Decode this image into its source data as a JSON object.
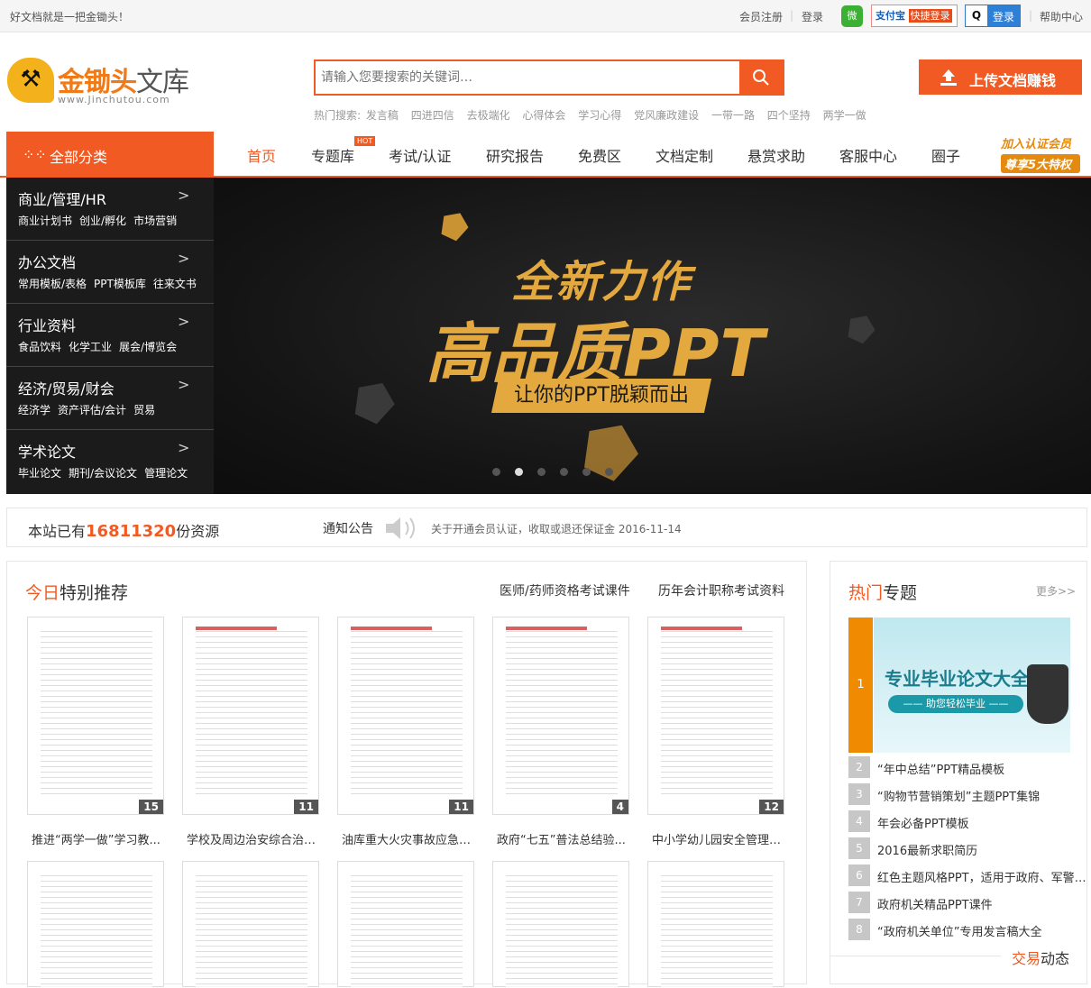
{
  "topbar": {
    "slogan": "好文档就是一把金锄头！",
    "register": "会员注册",
    "login": "登录",
    "wechat_icon": "wechat-icon",
    "alipay_label": "支付宝",
    "fast_login": "快捷登录",
    "qq_login": "登录",
    "help": "帮助中心"
  },
  "logo": {
    "name": "金锄头",
    "name_suffix": "文库",
    "url": "www.Jinchutou.com"
  },
  "search": {
    "placeholder": "请输入您要搜索的关键词…",
    "hot_label": "热门搜索:",
    "hot_terms": [
      "发言稿",
      "四进四信",
      "去极端化",
      "心得体会",
      "学习心得",
      "党风廉政建设",
      "一带一路",
      "四个坚持",
      "两学一做"
    ]
  },
  "upload": {
    "label": "上传文档赚钱"
  },
  "nav": {
    "all_categories": "全部分类",
    "items": [
      "首页",
      "专题库",
      "考试/认证",
      "研究报告",
      "免费区",
      "文档定制",
      "悬赏求助",
      "客服中心",
      "圈子"
    ],
    "hot_badge": "HOT",
    "member_line1": "加入认证会员",
    "member_line2": "尊享5大特权"
  },
  "categories": [
    {
      "title": "商业/管理/HR",
      "subs": [
        "商业计划书",
        "创业/孵化",
        "市场营销"
      ]
    },
    {
      "title": "办公文档",
      "subs": [
        "常用模板/表格",
        "PPT模板库",
        "往来文书"
      ]
    },
    {
      "title": "行业资料",
      "subs": [
        "食品饮料",
        "化学工业",
        "展会/博览会"
      ]
    },
    {
      "title": "经济/贸易/财会",
      "subs": [
        "经济学",
        "资产评估/会计",
        "贸易"
      ]
    },
    {
      "title": "学术论文",
      "subs": [
        "毕业论文",
        "期刊/会议论文",
        "管理论文"
      ]
    }
  ],
  "banner": {
    "line1": "全新力作",
    "line2": "高品质PPT",
    "line3": "让你的PPT脱颖而出",
    "active_slide": 2
  },
  "stats": {
    "prefix": "本站已有",
    "count": "16811320",
    "suffix": "份资源",
    "notice_label": "通知公告",
    "notice_text": "关于开通会员认证，收取或退还保证金",
    "notice_date": "2016-11-14"
  },
  "recommend": {
    "title_highlight": "今日",
    "title_rest": "特别推荐",
    "link1": "医师/药师资格考试课件",
    "link2": "历年会计职称考试资料",
    "docs": [
      {
        "title": "推进“两学一做”学习教...",
        "pages": "15"
      },
      {
        "title": "学校及周边治安综合治理...",
        "pages": "11"
      },
      {
        "title": "油库重大火灾事故应急预...",
        "pages": "11"
      },
      {
        "title": "政府“七五”普法总结验...",
        "pages": "4"
      },
      {
        "title": "中小学幼儿园安全管理和...",
        "pages": "12"
      }
    ]
  },
  "hot_topics": {
    "title_highlight": "热门",
    "title_rest": "专题",
    "more": "更多>>",
    "featured_text": "专业毕业论文大全",
    "featured_sub": "—— 助您轻松毕业 ——",
    "items": [
      {
        "num": "1",
        "title": ""
      },
      {
        "num": "2",
        "title": "“年中总结”PPT精品模板"
      },
      {
        "num": "3",
        "title": "“购物节营销策划”主题PPT集锦"
      },
      {
        "num": "4",
        "title": "年会必备PPT模板"
      },
      {
        "num": "5",
        "title": "2016最新求职简历"
      },
      {
        "num": "6",
        "title": "红色主题风格PPT，适用于政府、军警、年..."
      },
      {
        "num": "7",
        "title": "政府机关精品PPT课件"
      },
      {
        "num": "8",
        "title": "“政府机关单位”专用发言稿大全"
      }
    ]
  },
  "trade": {
    "highlight": "交易",
    "rest": "动态"
  },
  "colors": {
    "brand": "#f15a22",
    "banner_gold": "#e4a93e",
    "topic_orange": "#f08a00"
  }
}
